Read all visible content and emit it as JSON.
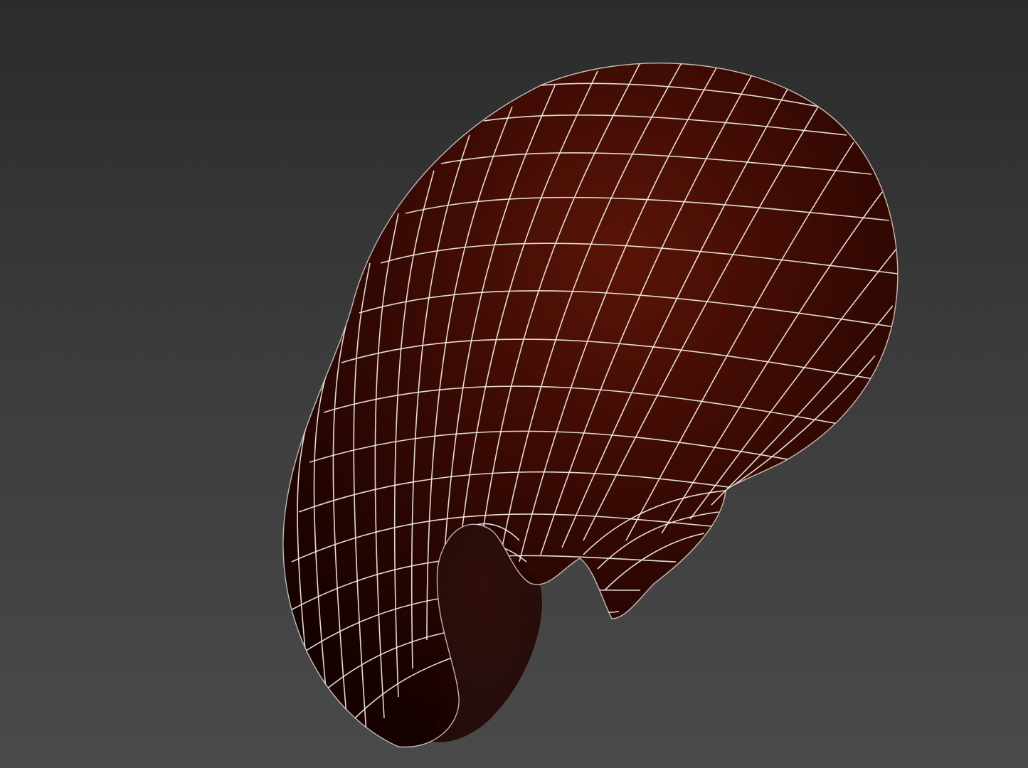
{
  "viewport": {
    "background_top": "#2b2b2b",
    "background_bottom": "#4a4a4a"
  },
  "model": {
    "name": "mesh-object",
    "display_mode": "shaded-wireframe",
    "surface_color": "#4a0f06",
    "surface_shadow_color": "#1a0200",
    "wire_color": "#f2efe8"
  }
}
